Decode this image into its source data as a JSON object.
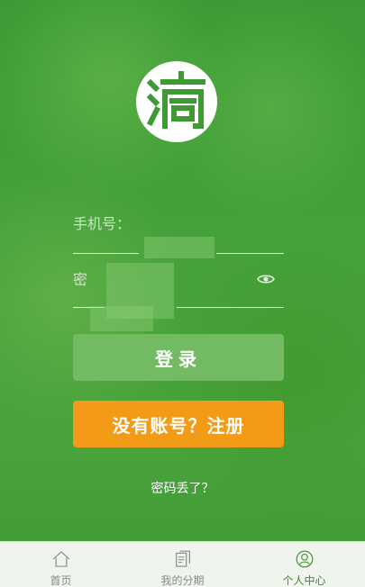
{
  "app": {
    "logo_char": "滴",
    "brand_color": "#3f9a34",
    "accent_color": "#f39a16"
  },
  "form": {
    "phone_label": "手机号：",
    "phone_value": "",
    "password_label": "密",
    "password_value": "",
    "show_password_icon": "eye-icon",
    "login_button": "登录",
    "register_button": "没有账号？注册",
    "forgot_password": "密码丢了？"
  },
  "tabbar": {
    "items": [
      {
        "label": "首页",
        "icon": "home-icon",
        "active": false
      },
      {
        "label": "我的分期",
        "icon": "document-icon",
        "active": false
      },
      {
        "label": "个人中心",
        "icon": "user-icon",
        "active": true
      }
    ]
  }
}
